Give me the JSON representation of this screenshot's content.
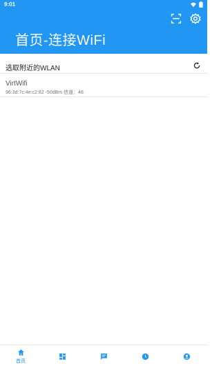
{
  "status": {
    "time": "9:01"
  },
  "appbar": {
    "title": "首页-连接WiFi"
  },
  "section": {
    "title": "选取附近的WLAN"
  },
  "networks": [
    {
      "ssid": "VirtWifi",
      "details": "96:3d:7c:4e:c2:82  -50dBm  信道：48"
    }
  ],
  "nav": [
    {
      "icon": "home-icon",
      "label": "首页",
      "active": true
    },
    {
      "icon": "dashboard-icon"
    },
    {
      "icon": "chat-icon"
    },
    {
      "icon": "clock-icon"
    },
    {
      "icon": "account-icon"
    }
  ],
  "colors": {
    "primary": "#2196f3",
    "divider": "#e6e6e6",
    "text_secondary": "#777777"
  }
}
